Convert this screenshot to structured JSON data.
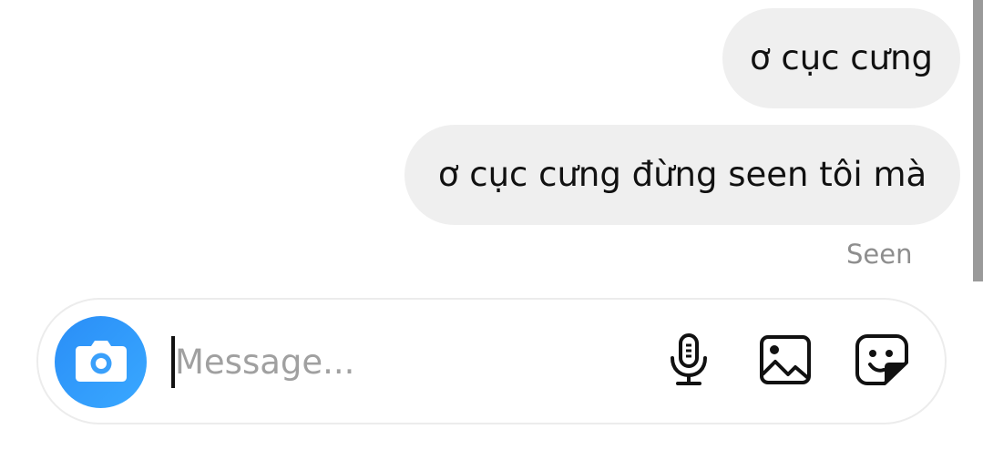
{
  "messages": [
    {
      "text": "ơ cục cưng"
    },
    {
      "text": "ơ cục cưng đừng seen tôi mà"
    }
  ],
  "status": {
    "seen_label": "Seen"
  },
  "composer": {
    "placeholder": "Message...",
    "value": "",
    "camera_icon": "camera-icon",
    "mic_icon": "microphone-icon",
    "gallery_icon": "image-icon",
    "sticker_icon": "sticker-icon",
    "accent_color": "#3797f0"
  }
}
